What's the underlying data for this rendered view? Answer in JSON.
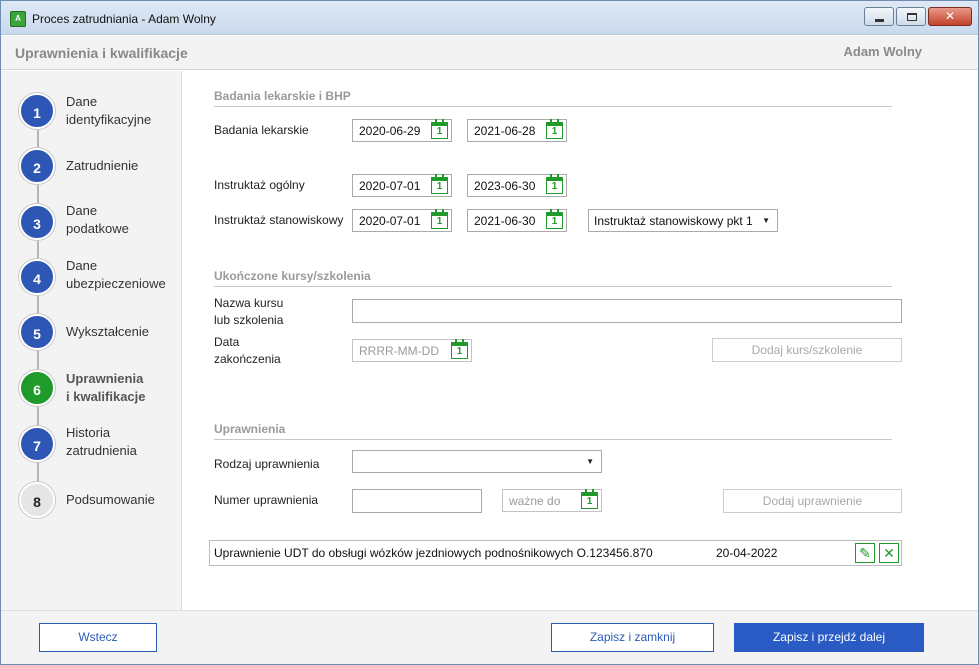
{
  "window": {
    "title": "Proces zatrudniania - Adam Wolny",
    "icon": "app-logo-icon",
    "controls": [
      "minimize-icon",
      "maximize-icon",
      "close-icon"
    ]
  },
  "header": {
    "page_title": "Uprawnienia i kwalifikacje",
    "user_name": "Adam Wolny"
  },
  "steps": [
    {
      "number": "1",
      "label_1": "Dane",
      "label_2": "identyfikacyjne",
      "state": "done"
    },
    {
      "number": "2",
      "label_1": "Zatrudnienie",
      "label_2": "",
      "state": "done"
    },
    {
      "number": "3",
      "label_1": "Dane",
      "label_2": "podatkowe",
      "state": "done"
    },
    {
      "number": "4",
      "label_1": "Dane",
      "label_2": "ubezpieczeniowe",
      "state": "done"
    },
    {
      "number": "5",
      "label_1": "Wykształcenie",
      "label_2": "",
      "state": "done"
    },
    {
      "number": "6",
      "label_1": "Uprawnienia",
      "label_2": "i kwalifikacje",
      "state": "active"
    },
    {
      "number": "7",
      "label_1": "Historia",
      "label_2": "zatrudnienia",
      "state": "done"
    },
    {
      "number": "8",
      "label_1": "Podsumowanie",
      "label_2": "",
      "state": "todo"
    }
  ],
  "medical": {
    "section_title": "Badania lekarskie i BHP",
    "badania_label": "Badania lekarskie",
    "badania_from": "2020-06-29",
    "badania_to": "2021-06-28",
    "ogolny_label": "Instruktaż ogólny",
    "ogolny_from": "2020-07-01",
    "ogolny_to": "2023-06-30",
    "stanowiskowy_label": "Instruktaż stanowiskowy",
    "stanowiskowy_from": "2020-07-01",
    "stanowiskowy_to": "2021-06-30",
    "stanowiskowy_type": "Instruktaż stanowiskowy pkt 1",
    "calendar_day": "1"
  },
  "courses": {
    "section_title": "Ukończone kursy/szkolenia",
    "name_label_1": "Nazwa kursu",
    "name_label_2": "lub szkolenia",
    "name_value": "",
    "date_label_1": "Data",
    "date_label_2": "zakończenia",
    "date_placeholder": "RRRR-MM-DD",
    "add_button": "Dodaj kurs/szkolenie"
  },
  "permissions": {
    "section_title": "Uprawnienia",
    "type_label": "Rodzaj uprawnienia",
    "type_value": "",
    "number_label": "Numer uprawnienia",
    "number_value": "",
    "valid_placeholder": "ważne do",
    "add_button": "Dodaj uprawnienie",
    "entries": [
      {
        "name": "Uprawnienie UDT do obsługi wózków jezdniowych podnośnikowych O.123456.870",
        "date": "20-04-2022"
      }
    ]
  },
  "footer": {
    "back": "Wstecz",
    "save_close": "Zapisz i zamknij",
    "save_next": "Zapisz i przejdź dalej"
  },
  "colors": {
    "accent_blue": "#2a5bc4",
    "active_green": "#1f9a2b"
  }
}
